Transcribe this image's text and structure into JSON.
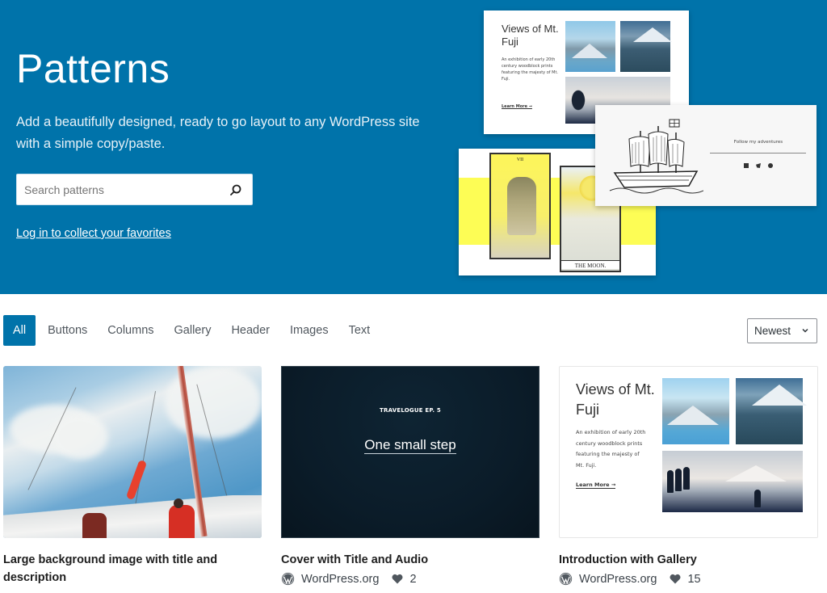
{
  "hero": {
    "title": "Patterns",
    "description": "Add a beautifully designed, ready to go layout to any WordPress site with a simple copy/paste.",
    "search_placeholder": "Search patterns",
    "search_value": "",
    "login_link": "Log in to collect your favorites",
    "background_color": "#0073aa",
    "previews": {
      "fuji": {
        "title": "Views of Mt. Fuji",
        "description": "An exhibition of early 20th century woodblock prints featuring the majesty of Mt. Fuji.",
        "link": "Learn More →"
      },
      "ship": {
        "caption": "Follow my adventures",
        "icons": [
          "mail-icon",
          "twitter-icon",
          "facebook-icon"
        ]
      },
      "tarot": {
        "card1_numeral": "VII",
        "card2_caption": "THE MOON."
      }
    }
  },
  "filters": {
    "tabs": [
      {
        "label": "All",
        "active": true
      },
      {
        "label": "Buttons",
        "active": false
      },
      {
        "label": "Columns",
        "active": false
      },
      {
        "label": "Gallery",
        "active": false
      },
      {
        "label": "Header",
        "active": false
      },
      {
        "label": "Images",
        "active": false
      },
      {
        "label": "Text",
        "active": false
      }
    ],
    "sort": {
      "selected": "Newest"
    }
  },
  "patterns": [
    {
      "title": "Large background image with title and description",
      "thumbnail": "watercolor-sailboat",
      "author": "",
      "favorites": null
    },
    {
      "title": "Cover with Title and Audio",
      "thumbnail": "dark-cover",
      "thumbnail_kicker": "TRAVELOGUE EP. 5",
      "thumbnail_heading": "One small step",
      "author": "WordPress.org",
      "favorites": "2"
    },
    {
      "title": "Introduction with Gallery",
      "thumbnail": "fuji-gallery",
      "thumbnail_heading": "Views of Mt. Fuji",
      "thumbnail_description": "An exhibition of early 20th century woodblock prints featuring the majesty of Mt. Fuji.",
      "thumbnail_link": "Learn More →",
      "author": "WordPress.org",
      "favorites": "15"
    }
  ]
}
